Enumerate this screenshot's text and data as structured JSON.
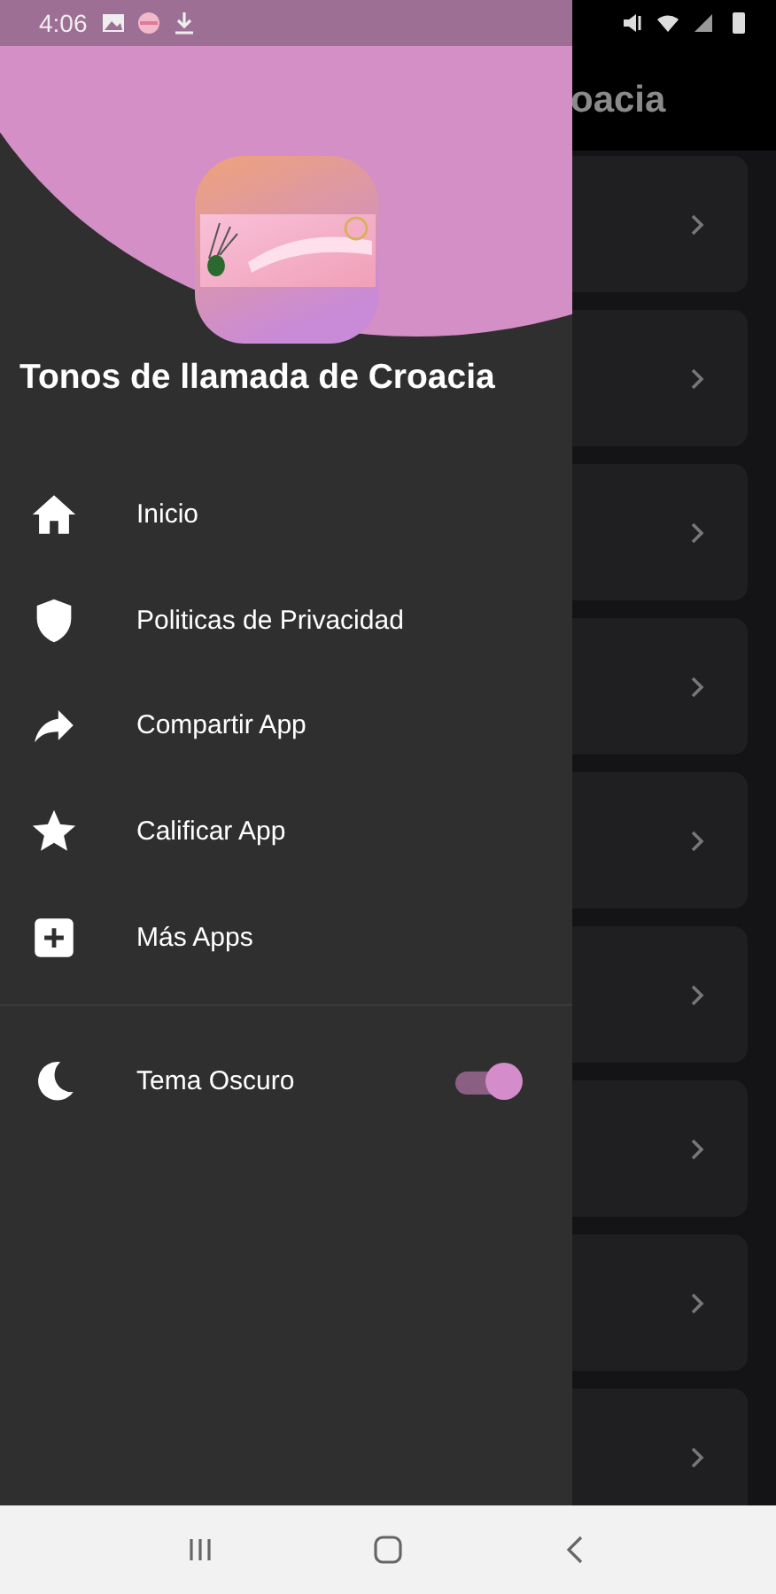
{
  "status_bar": {
    "time": "4:06"
  },
  "app_bar": {
    "title": "oacia"
  },
  "cards": [
    {
      "kind": "chevron"
    },
    {
      "kind": "chevron"
    },
    {
      "kind": "chevron"
    },
    {
      "kind": "chevron"
    },
    {
      "kind": "chevron"
    },
    {
      "kind": "chevron"
    },
    {
      "kind": "chevron"
    },
    {
      "kind": "chevron"
    },
    {
      "kind": "chevron"
    }
  ],
  "drawer": {
    "title": "Tonos de llamada de Croacia",
    "items": [
      {
        "kind": "home",
        "label": "Inicio"
      },
      {
        "kind": "shield",
        "label": "Politicas de Privacidad"
      },
      {
        "kind": "share",
        "label": "Compartir App"
      },
      {
        "kind": "star",
        "label": "Calificar App"
      },
      {
        "kind": "plus",
        "label": "Más Apps"
      }
    ],
    "theme_toggle": {
      "label": "Tema Oscuro",
      "on": true
    }
  }
}
